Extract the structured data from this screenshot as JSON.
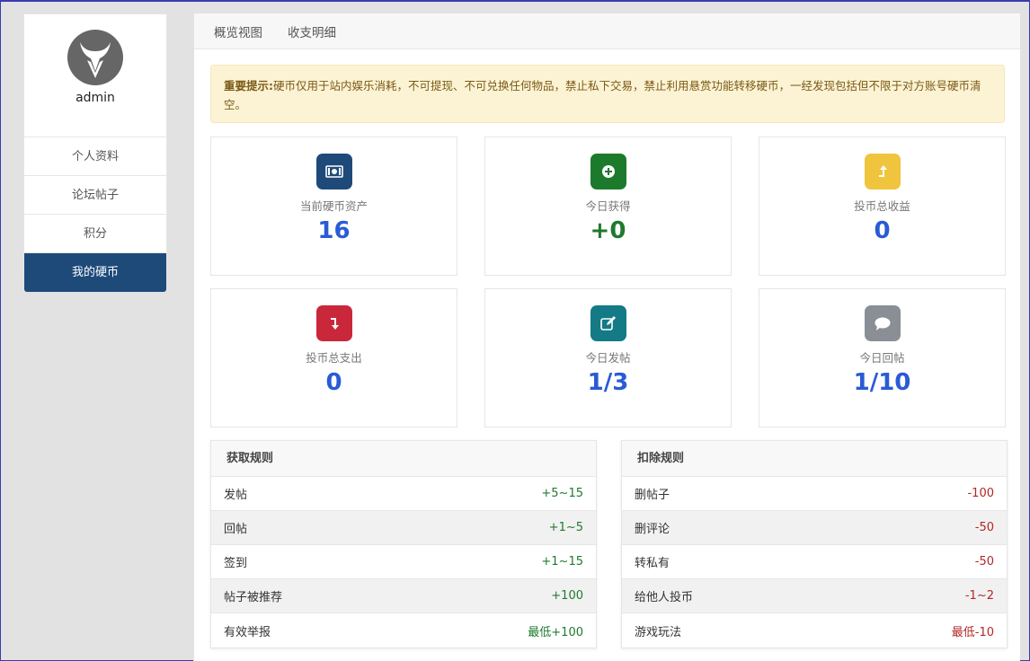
{
  "sidebar": {
    "username": "admin",
    "items": [
      {
        "label": "个人资料"
      },
      {
        "label": "论坛帖子"
      },
      {
        "label": "积分"
      },
      {
        "label": "我的硬币"
      }
    ]
  },
  "tabs": [
    {
      "label": "概览视图"
    },
    {
      "label": "收支明细"
    }
  ],
  "notice": {
    "title": "重要提示:",
    "text": "硬币仅用于站内娱乐消耗，不可提现、不可兑换任何物品，禁止私下交易，禁止利用悬赏功能转移硬币，一经发现包括但不限于对方账号硬币清空。"
  },
  "stats": [
    {
      "icon": "money-icon",
      "color": "#1e4a7a",
      "label": "当前硬币资产",
      "value": "16"
    },
    {
      "icon": "plus-circle-icon",
      "color": "#1c7a2c",
      "label": "今日获得",
      "value": "+0"
    },
    {
      "icon": "arrow-up-icon",
      "color": "#f0c43c",
      "label": "投币总收益",
      "value": "0"
    },
    {
      "icon": "arrow-down-icon",
      "color": "#c9283a",
      "label": "投币总支出",
      "value": "0"
    },
    {
      "icon": "edit-icon",
      "color": "#137a86",
      "label": "今日发帖",
      "value": "1/3"
    },
    {
      "icon": "comment-icon",
      "color": "#8a8f96",
      "label": "今日回帖",
      "value": "1/10"
    }
  ],
  "earn_rules": {
    "title": "获取规则",
    "rows": [
      {
        "name": "发帖",
        "value": "+5~15"
      },
      {
        "name": "回帖",
        "value": "+1~5"
      },
      {
        "name": "签到",
        "value": "+1~15"
      },
      {
        "name": "帖子被推荐",
        "value": "+100"
      },
      {
        "name": "有效举报",
        "value": "最低+100"
      }
    ]
  },
  "deduct_rules": {
    "title": "扣除规则",
    "rows": [
      {
        "name": "删帖子",
        "value": "-100"
      },
      {
        "name": "删评论",
        "value": "-50"
      },
      {
        "name": "转私有",
        "value": "-50"
      },
      {
        "name": "给他人投币",
        "value": "-1~2"
      },
      {
        "name": "游戏玩法",
        "value": "最低-10"
      }
    ]
  }
}
